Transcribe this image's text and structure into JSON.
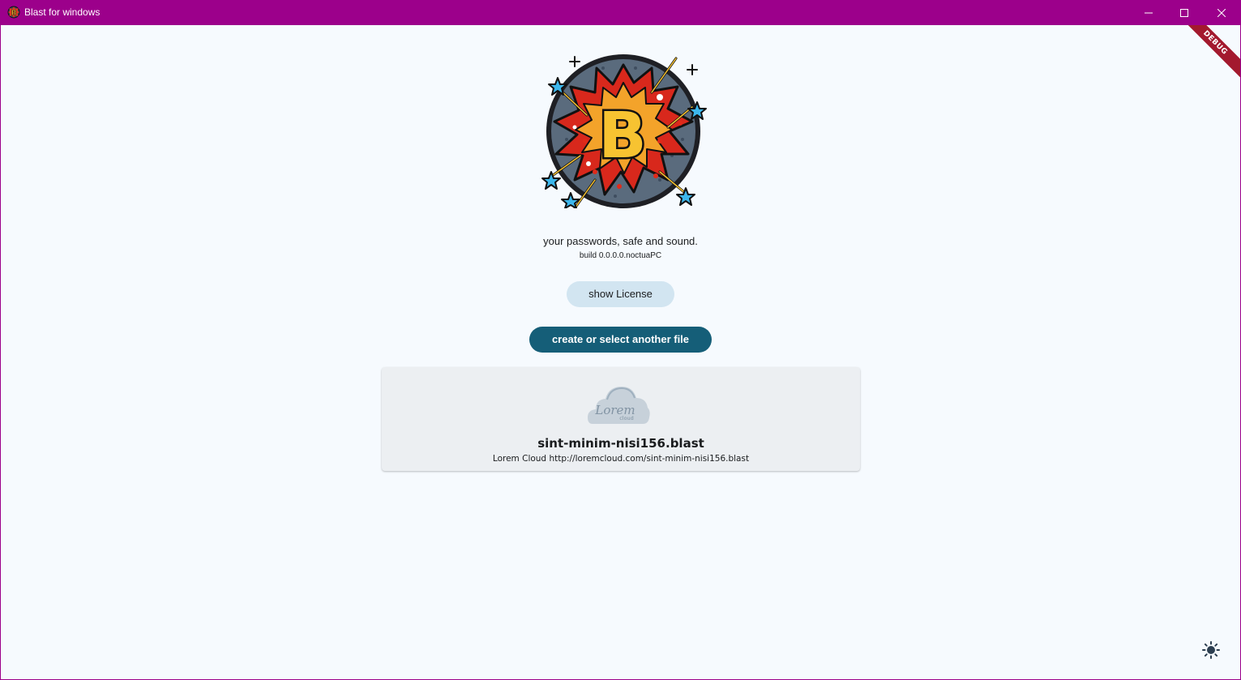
{
  "window": {
    "title": "Blast for windows",
    "controls": {
      "minimize": "minimize-icon",
      "maximize": "maximize-icon",
      "close": "close-icon"
    }
  },
  "debug_banner": "DEBUG",
  "logo": {
    "letter": "B",
    "icon": "blast-logo"
  },
  "tagline": "your passwords, safe and sound.",
  "build": "build 0.0.0.0.noctuaPC",
  "buttons": {
    "show_license": "show License",
    "create_or_select": "create or select another file"
  },
  "recent_file": {
    "provider_logo_text": "Lorem",
    "provider_logo_subtext": "cloud",
    "name": "sint-minim-nisi156.blast",
    "description": "Lorem Cloud http://loremcloud.com/sint-minim-nisi156.blast"
  },
  "theme_toggle": {
    "icon": "brightness-icon"
  },
  "colors": {
    "titlebar": "#9c008b",
    "background": "#f6fafe",
    "primary_button": "#155e78",
    "secondary_button": "#d2e5f1",
    "card": "#eceff2",
    "debug_ribbon": "#a3192e"
  }
}
